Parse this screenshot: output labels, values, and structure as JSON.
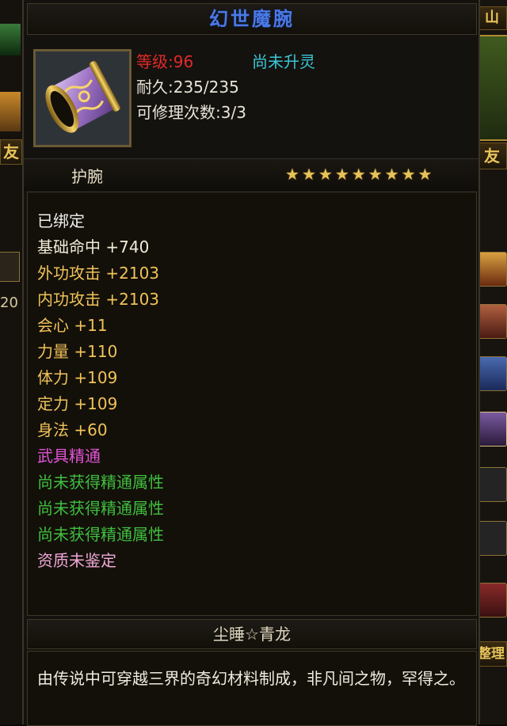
{
  "item": {
    "name": "幻世魔腕",
    "level_label": "等级:96",
    "spirit_status": "尚未升灵",
    "durability_label": "耐久:235/235",
    "repair_label": "可修理次数:3/3",
    "slot_type": "护腕",
    "star_count": 9,
    "set_name": "尘睡☆青龙",
    "description": "由传说中可穿越三界的奇幻材料制成，非凡间之物，罕得之。"
  },
  "attributes": [
    {
      "text": "已绑定",
      "color": "#f0f0f0"
    },
    {
      "text": "基础命中 +740",
      "color": "#f2ecd8"
    },
    {
      "text": "外功攻击 +2103",
      "color": "#f0c25a"
    },
    {
      "text": "内功攻击 +2103",
      "color": "#f0c25a"
    },
    {
      "text": "会心 +11",
      "color": "#f0c25a"
    },
    {
      "text": "力量 +110",
      "color": "#f0c25a"
    },
    {
      "text": "体力 +109",
      "color": "#f0c25a"
    },
    {
      "text": "定力 +109",
      "color": "#f0c25a"
    },
    {
      "text": "身法 +60",
      "color": "#f0c25a"
    },
    {
      "text": "武具精通",
      "color": "#e354d8"
    },
    {
      "text": "尚未获得精通属性",
      "color": "#3fbf3f"
    },
    {
      "text": "尚未获得精通属性",
      "color": "#3fbf3f"
    },
    {
      "text": "尚未获得精通属性",
      "color": "#3fbf3f"
    },
    {
      "text": "资质未鉴定",
      "color": "#f0a8d8"
    }
  ],
  "background_ui": {
    "left_tab": "友",
    "right_tab_top": "山",
    "right_tab_mid": "友",
    "right_tab_bottom": "整理",
    "left_number": "20"
  },
  "colors": {
    "title": "#4a79e8",
    "level": "#e02a2a",
    "spirit": "#3ac6d8",
    "normal_text": "#e8e4d8",
    "star": "#e6c35a"
  },
  "icons": {
    "item_icon": "bracer-icon",
    "star": "star-icon"
  }
}
